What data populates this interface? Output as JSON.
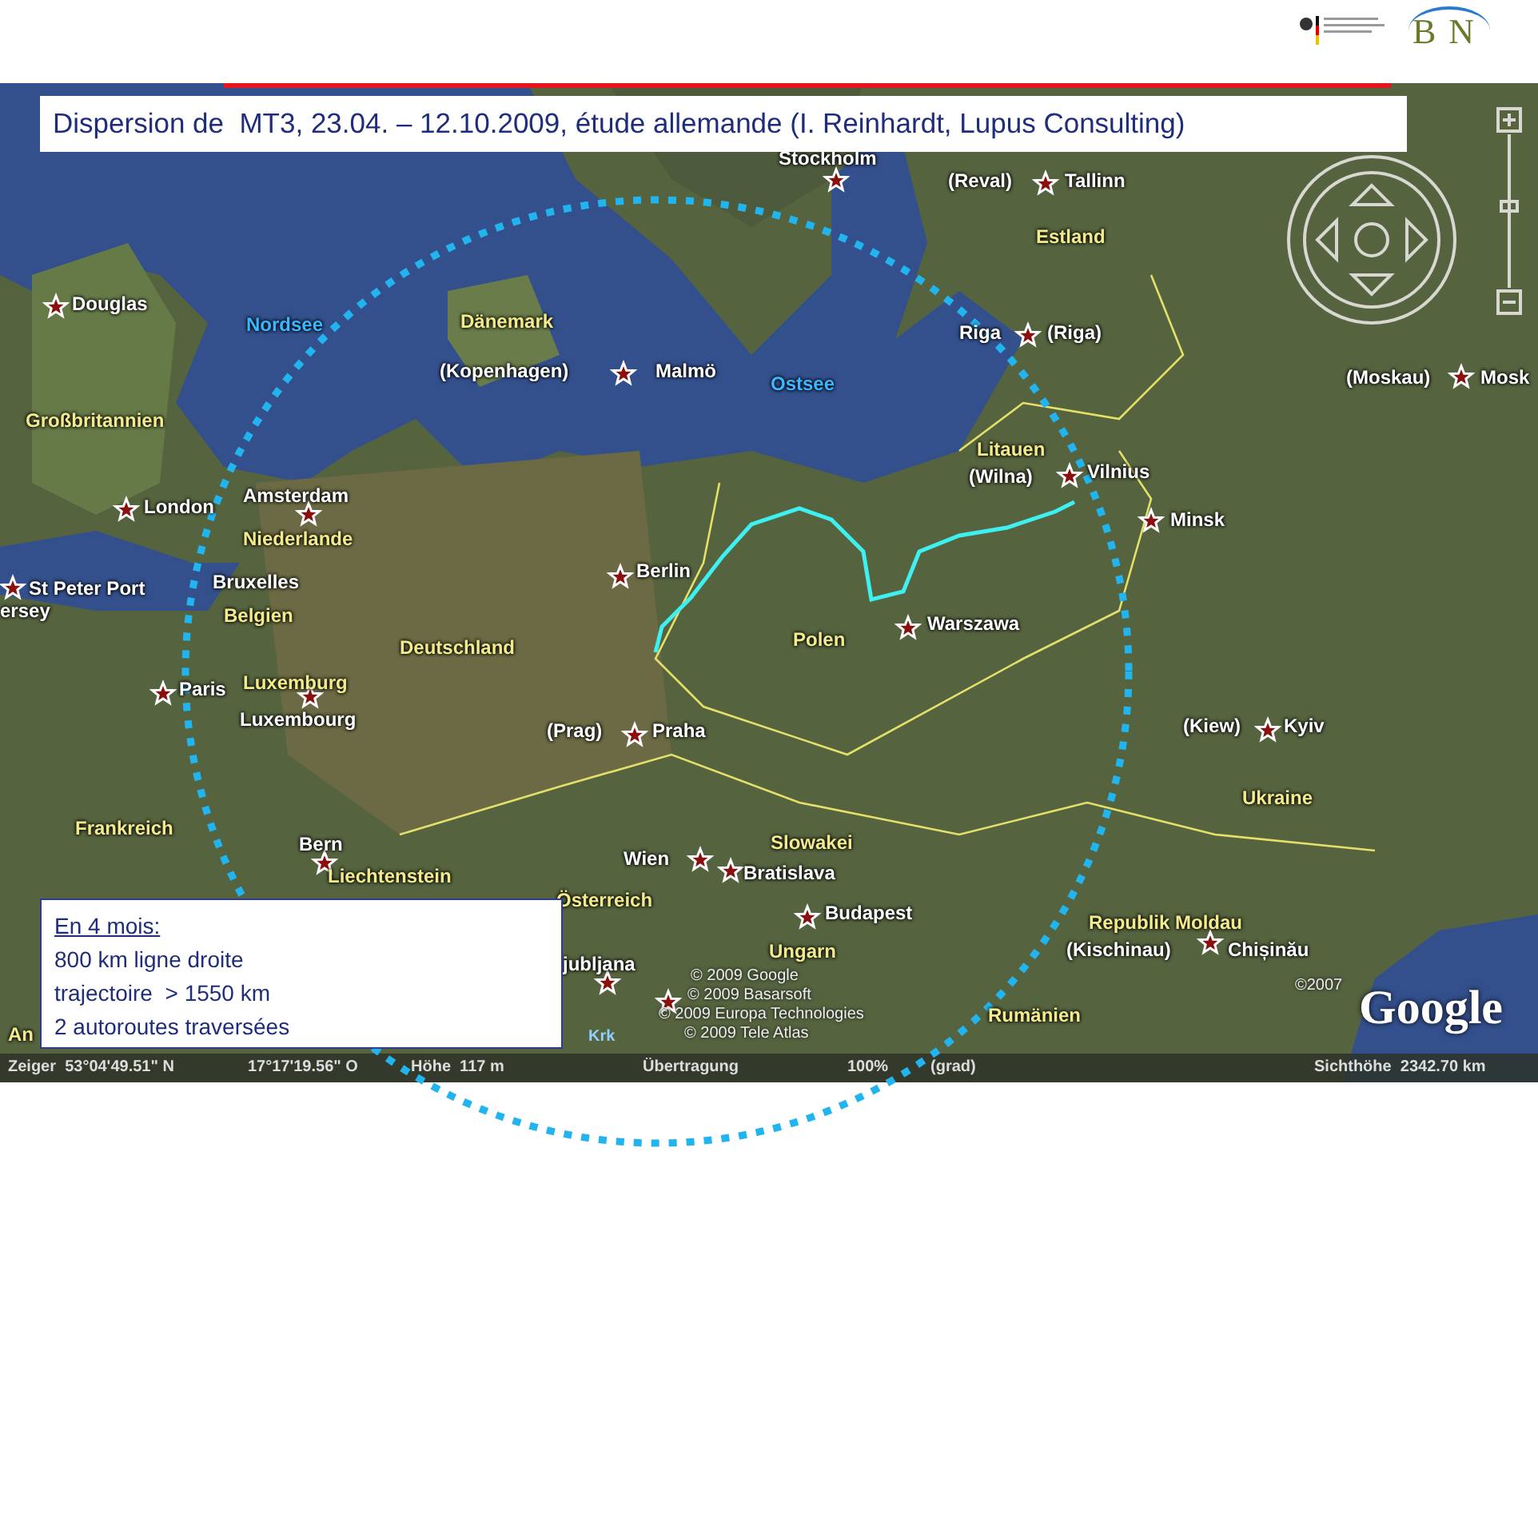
{
  "header": {
    "logo_text": "BN"
  },
  "title": "Dispersion de  MT3, 23.04. – 12.10.2009, étude allemande (I. Reinhardt, Lupus Consulting)",
  "map_labels": [
    {
      "kind": "city",
      "text": "Stockholm"
    },
    {
      "kind": "city",
      "text": "(Reval)"
    },
    {
      "kind": "city",
      "text": "Tallinn"
    },
    {
      "kind": "country",
      "text": "Estland"
    },
    {
      "kind": "city",
      "text": "Douglas"
    },
    {
      "kind": "sea",
      "text": "Nordsee"
    },
    {
      "kind": "country",
      "text": "Dänemark"
    },
    {
      "kind": "city",
      "text": "(Kopenhagen)"
    },
    {
      "kind": "city",
      "text": "Malmö"
    },
    {
      "kind": "sea",
      "text": "Ostsee"
    },
    {
      "kind": "city",
      "text": "Riga"
    },
    {
      "kind": "city",
      "text": "(Riga)"
    },
    {
      "kind": "city",
      "text": "(Moskau)"
    },
    {
      "kind": "city",
      "text": "Mosk"
    },
    {
      "kind": "country",
      "text": "Großbritannien"
    },
    {
      "kind": "country",
      "text": "Litauen"
    },
    {
      "kind": "city",
      "text": "(Wilna)"
    },
    {
      "kind": "city",
      "text": "Vilnius"
    },
    {
      "kind": "city",
      "text": "Amsterdam"
    },
    {
      "kind": "city",
      "text": "London"
    },
    {
      "kind": "country",
      "text": "Niederlande"
    },
    {
      "kind": "city",
      "text": "Minsk"
    },
    {
      "kind": "city",
      "text": "Berlin"
    },
    {
      "kind": "city",
      "text": "St Peter Port"
    },
    {
      "kind": "city",
      "text": "ersey"
    },
    {
      "kind": "city",
      "text": "Bruxelles"
    },
    {
      "kind": "country",
      "text": "Belgien"
    },
    {
      "kind": "city",
      "text": "Warszawa"
    },
    {
      "kind": "country",
      "text": "Polen"
    },
    {
      "kind": "country",
      "text": "Deutschland"
    },
    {
      "kind": "city",
      "text": "Paris"
    },
    {
      "kind": "country",
      "text": "Luxemburg"
    },
    {
      "kind": "city",
      "text": "Luxembourg"
    },
    {
      "kind": "city",
      "text": "(Prag)"
    },
    {
      "kind": "city",
      "text": "Praha"
    },
    {
      "kind": "city",
      "text": "(Kiew)"
    },
    {
      "kind": "city",
      "text": "Kyiv"
    },
    {
      "kind": "country",
      "text": "Ukraine"
    },
    {
      "kind": "country",
      "text": "Frankreich"
    },
    {
      "kind": "city",
      "text": "Bern"
    },
    {
      "kind": "country",
      "text": "Liechtenstein"
    },
    {
      "kind": "country",
      "text": "Slowakei"
    },
    {
      "kind": "city",
      "text": "Wien"
    },
    {
      "kind": "city",
      "text": "Bratislava"
    },
    {
      "kind": "country",
      "text": "Österreich"
    },
    {
      "kind": "city",
      "text": "Budapest"
    },
    {
      "kind": "country",
      "text": "Republik Moldau"
    },
    {
      "kind": "country",
      "text": "Ungarn"
    },
    {
      "kind": "city",
      "text": "(Kischinau)"
    },
    {
      "kind": "city",
      "text": "Chișinău"
    },
    {
      "kind": "city",
      "text": "jubljana"
    },
    {
      "kind": "country",
      "text": "Rumänien"
    },
    {
      "kind": "country",
      "text": "An"
    },
    {
      "kind": "island",
      "text": "Krk"
    },
    {
      "kind": "copyright",
      "text": "© 2009 Google"
    },
    {
      "kind": "copyright",
      "text": "© 2009 Basarsoft"
    },
    {
      "kind": "copyright",
      "text": "© 2009 Europa Technologies"
    },
    {
      "kind": "copyright",
      "text": "© 2009 Tele Atlas"
    },
    {
      "kind": "copyright",
      "text": "©2007"
    },
    {
      "kind": "brand",
      "text": "Google"
    }
  ],
  "status_bar": [
    {
      "text": "Zeiger  53°04'49.51\" N"
    },
    {
      "text": "17°17'19.56\" O"
    },
    {
      "text": "Höhe  117 m"
    },
    {
      "text": "Übertragung"
    },
    {
      "text": "100%"
    },
    {
      "text": "(grad)"
    },
    {
      "text": "Sichthöhe  2342.70 km"
    }
  ],
  "info_box": {
    "heading": "En 4 mois:",
    "lines": [
      "800 km ligne droite",
      "trajectoire  > 1550 km",
      "2 autoroutes traversées"
    ]
  }
}
